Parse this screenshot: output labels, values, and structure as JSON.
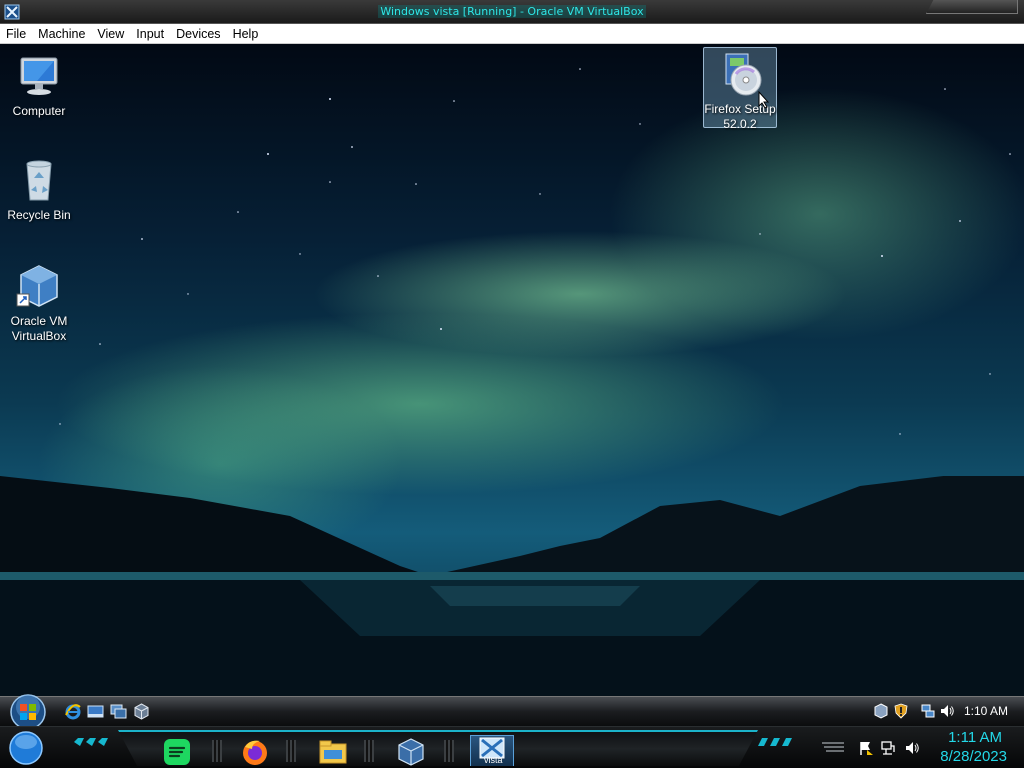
{
  "window": {
    "title": "Windows vista [Running] - Oracle VM VirtualBox"
  },
  "menubar": {
    "items": [
      "File",
      "Machine",
      "View",
      "Input",
      "Devices",
      "Help"
    ]
  },
  "desktop": {
    "icons": [
      {
        "name": "computer-icon",
        "label": "Computer"
      },
      {
        "name": "recycle-bin-icon",
        "label": "Recycle Bin"
      },
      {
        "name": "virtualbox-icon",
        "label_line1": "Oracle VM",
        "label_line2": "VirtualBox"
      },
      {
        "name": "firefox-setup-icon",
        "label_line1": "Firefox Setup",
        "label_line2": "52.0.2",
        "selected": true
      }
    ]
  },
  "guest_taskbar": {
    "quick_launch": [
      "internet-explorer-icon",
      "show-desktop-icon",
      "switch-windows-icon",
      "virtualbox-icon"
    ],
    "tray": [
      "virtualbox-tray-icon",
      "security-shield-icon",
      "network-icon",
      "volume-icon"
    ],
    "clock": "1:10 AM"
  },
  "host_dock": {
    "apps": [
      "spotify-icon",
      "firefox-icon",
      "file-explorer-icon",
      "virtualbox-icon",
      "vista-vm-icon"
    ],
    "vista_label": "vista",
    "tray": [
      "action-center-flag-icon",
      "network-icon",
      "volume-icon"
    ],
    "time": "1:11 AM",
    "date": "8/28/2023"
  },
  "colors": {
    "accent_cyan": "#23d8e8",
    "aurora_green": "#7fe3a0"
  }
}
